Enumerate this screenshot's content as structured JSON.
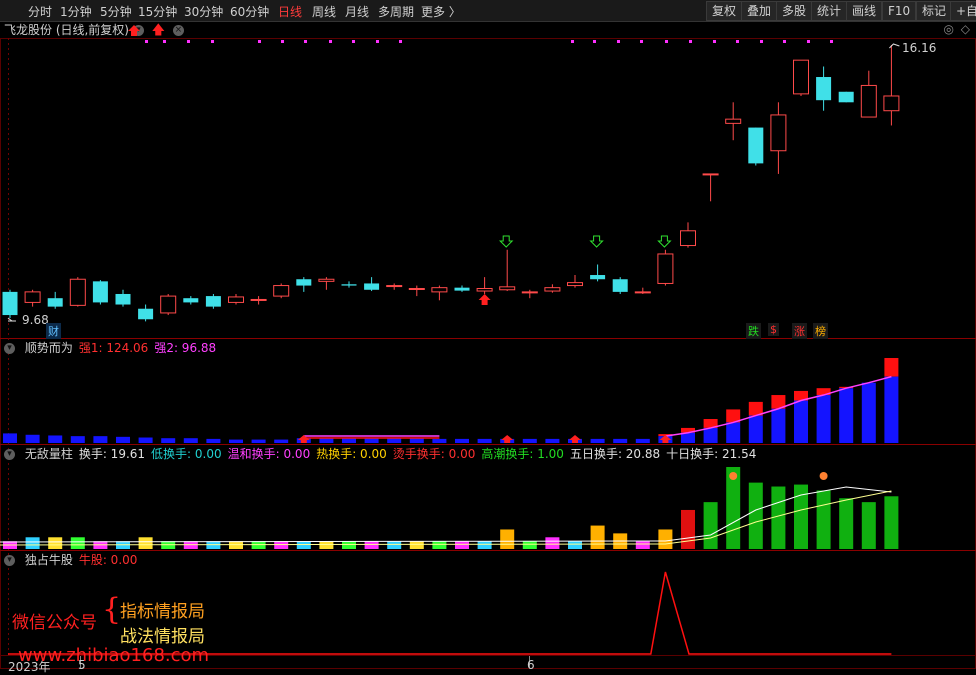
{
  "toolbar": {
    "periods": [
      "分时",
      "1分钟",
      "5分钟",
      "15分钟",
      "30分钟",
      "60分钟",
      "日线",
      "周线",
      "月线",
      "多周期",
      "更多 〉"
    ],
    "active_period": "日线",
    "buttons": [
      "复权",
      "叠加",
      "多股",
      "统计",
      "画线",
      "F10",
      "标记",
      "+自选"
    ]
  },
  "chart": {
    "stock_title": "飞龙股份 (日线,前复权)",
    "high_label": "16.16",
    "low_label": "9.68",
    "finance_tag": "财",
    "tags": [
      {
        "text": "跌",
        "color": "#22dd22"
      },
      {
        "text": "$",
        "color": "#ff3030"
      },
      {
        "text": "涨",
        "color": "#ff3030"
      },
      {
        "text": "榜",
        "color": "#ffb000"
      }
    ]
  },
  "panel2": {
    "name": "顺势而为",
    "items": [
      {
        "label": "强1: 124.06",
        "color": "#ff3030"
      },
      {
        "label": "强2: 96.88",
        "color": "#ff40ff"
      }
    ]
  },
  "panel3": {
    "name": "无敌量柱",
    "items": [
      {
        "label": "换手: 19.61",
        "color": "#e0e0e0"
      },
      {
        "label": "低换手: 0.00",
        "color": "#20d0d0"
      },
      {
        "label": "温和换手: 0.00",
        "color": "#ff40ff"
      },
      {
        "label": "热换手: 0.00",
        "color": "#ffd000"
      },
      {
        "label": "烫手换手: 0.00",
        "color": "#ff3030"
      },
      {
        "label": "高潮换手: 1.00",
        "color": "#22dd22"
      },
      {
        "label": "五日换手: 20.88",
        "color": "#e0e0e0"
      },
      {
        "label": "十日换手: 21.54",
        "color": "#e0e0e0"
      }
    ]
  },
  "panel4": {
    "name": "独占牛股",
    "items": [
      {
        "label": "牛股: 0.00",
        "color": "#ff3030"
      }
    ]
  },
  "watermark": {
    "wechat_label": "微信公众号",
    "line1": "指标情报局",
    "line2": "战法情报局",
    "url": "www.zhibiao168.com"
  },
  "x_axis": {
    "year": "2023年",
    "m5": "5",
    "m6": "6"
  },
  "candles": [
    {
      "o": 10.3,
      "c": 9.75,
      "h": 10.35,
      "l": 9.68
    },
    {
      "o": 10.05,
      "c": 10.3,
      "h": 10.35,
      "l": 9.95
    },
    {
      "o": 10.15,
      "c": 9.95,
      "h": 10.3,
      "l": 9.9
    },
    {
      "o": 9.98,
      "c": 10.6,
      "h": 10.65,
      "l": 9.95
    },
    {
      "o": 10.55,
      "c": 10.05,
      "h": 10.58,
      "l": 10.0
    },
    {
      "o": 10.25,
      "c": 10.0,
      "h": 10.35,
      "l": 9.95
    },
    {
      "o": 9.9,
      "c": 9.65,
      "h": 10.0,
      "l": 9.6
    },
    {
      "o": 9.8,
      "c": 10.2,
      "h": 10.25,
      "l": 9.75
    },
    {
      "o": 10.15,
      "c": 10.05,
      "h": 10.2,
      "l": 10.0
    },
    {
      "o": 10.2,
      "c": 9.95,
      "h": 10.25,
      "l": 9.9
    },
    {
      "o": 10.05,
      "c": 10.18,
      "h": 10.25,
      "l": 10.0
    },
    {
      "o": 10.12,
      "c": 10.12,
      "h": 10.2,
      "l": 10.0
    },
    {
      "o": 10.2,
      "c": 10.45,
      "h": 10.5,
      "l": 10.15
    },
    {
      "o": 10.6,
      "c": 10.45,
      "h": 10.65,
      "l": 10.3
    },
    {
      "o": 10.55,
      "c": 10.6,
      "h": 10.65,
      "l": 10.35
    },
    {
      "o": 10.48,
      "c": 10.45,
      "h": 10.55,
      "l": 10.4
    },
    {
      "o": 10.5,
      "c": 10.35,
      "h": 10.65,
      "l": 10.32
    },
    {
      "o": 10.43,
      "c": 10.45,
      "h": 10.5,
      "l": 10.35
    },
    {
      "o": 10.38,
      "c": 10.38,
      "h": 10.45,
      "l": 10.2
    },
    {
      "o": 10.3,
      "c": 10.4,
      "h": 10.45,
      "l": 10.1
    },
    {
      "o": 10.4,
      "c": 10.33,
      "h": 10.45,
      "l": 10.3
    },
    {
      "o": 10.32,
      "c": 10.38,
      "h": 10.65,
      "l": 10.25
    },
    {
      "o": 10.35,
      "c": 10.42,
      "h": 11.3,
      "l": 10.32
    },
    {
      "o": 10.3,
      "c": 10.3,
      "h": 10.35,
      "l": 10.15
    },
    {
      "o": 10.32,
      "c": 10.4,
      "h": 10.48,
      "l": 10.28
    },
    {
      "o": 10.45,
      "c": 10.52,
      "h": 10.7,
      "l": 10.4
    },
    {
      "o": 10.7,
      "c": 10.6,
      "h": 10.95,
      "l": 10.55
    },
    {
      "o": 10.6,
      "c": 10.3,
      "h": 10.65,
      "l": 10.25
    },
    {
      "o": 10.3,
      "c": 10.3,
      "h": 10.4,
      "l": 10.25
    },
    {
      "o": 10.5,
      "c": 11.2,
      "h": 11.3,
      "l": 10.45
    },
    {
      "o": 11.4,
      "c": 11.75,
      "h": 11.95,
      "l": 11.35
    },
    {
      "o": 13.1,
      "c": 13.1,
      "h": 13.1,
      "l": 12.45
    },
    {
      "o": 14.3,
      "c": 14.4,
      "h": 14.8,
      "l": 13.9
    },
    {
      "o": 14.2,
      "c": 13.35,
      "h": 14.2,
      "l": 13.3
    },
    {
      "o": 13.65,
      "c": 14.5,
      "h": 14.8,
      "l": 13.1
    },
    {
      "o": 15.0,
      "c": 15.8,
      "h": 15.8,
      "l": 14.95
    },
    {
      "o": 15.4,
      "c": 14.85,
      "h": 15.65,
      "l": 14.6
    },
    {
      "o": 15.05,
      "c": 14.8,
      "h": 15.05,
      "l": 14.8
    },
    {
      "o": 14.45,
      "c": 15.2,
      "h": 15.55,
      "l": 14.45
    },
    {
      "o": 14.6,
      "c": 14.95,
      "h": 16.16,
      "l": 14.25
    }
  ],
  "strength_bars": [
    {
      "blue": 14,
      "red": 14
    },
    {
      "blue": 12,
      "red": 12
    },
    {
      "blue": 11,
      "red": 11
    },
    {
      "blue": 10,
      "red": 10
    },
    {
      "blue": 10,
      "red": 10
    },
    {
      "blue": 9,
      "red": 9
    },
    {
      "blue": 8,
      "red": 8
    },
    {
      "blue": 7,
      "red": 7
    },
    {
      "blue": 7,
      "red": 7
    },
    {
      "blue": 6,
      "red": 6
    },
    {
      "blue": 5,
      "red": 5
    },
    {
      "blue": 5,
      "red": 5
    },
    {
      "blue": 5,
      "red": 5
    },
    {
      "blue": 7,
      "red": 7
    },
    {
      "blue": 7,
      "red": 7
    },
    {
      "blue": 7,
      "red": 7
    },
    {
      "blue": 7,
      "red": 7
    },
    {
      "blue": 7,
      "red": 7
    },
    {
      "blue": 7,
      "red": 7
    },
    {
      "blue": 6,
      "red": 6
    },
    {
      "blue": 6,
      "red": 6
    },
    {
      "blue": 6,
      "red": 6
    },
    {
      "blue": 6,
      "red": 6
    },
    {
      "blue": 6,
      "red": 6
    },
    {
      "blue": 6,
      "red": 6
    },
    {
      "blue": 6,
      "red": 6
    },
    {
      "blue": 6,
      "red": 6
    },
    {
      "blue": 6,
      "red": 6
    },
    {
      "blue": 6,
      "red": 6
    },
    {
      "blue": 10,
      "red": 13
    },
    {
      "blue": 15,
      "red": 22
    },
    {
      "blue": 22,
      "red": 35
    },
    {
      "blue": 30,
      "red": 49
    },
    {
      "blue": 40,
      "red": 60
    },
    {
      "blue": 50,
      "red": 70
    },
    {
      "blue": 62,
      "red": 76
    },
    {
      "blue": 70,
      "red": 80
    },
    {
      "blue": 80,
      "red": 82
    },
    {
      "blue": 88,
      "red": 83
    },
    {
      "blue": 96.88,
      "red": 124.06
    }
  ],
  "volume_bars": [
    {
      "v": 2,
      "c": "multi"
    },
    {
      "v": 3,
      "c": "multi"
    },
    {
      "v": 3,
      "c": "multi"
    },
    {
      "v": 3,
      "c": "multi"
    },
    {
      "v": 2,
      "c": "multi"
    },
    {
      "v": 2,
      "c": "multi"
    },
    {
      "v": 3,
      "c": "multi"
    },
    {
      "v": 2,
      "c": "multi"
    },
    {
      "v": 2,
      "c": "multi"
    },
    {
      "v": 2,
      "c": "multi"
    },
    {
      "v": 2,
      "c": "multi"
    },
    {
      "v": 2,
      "c": "multi"
    },
    {
      "v": 2,
      "c": "multi"
    },
    {
      "v": 2,
      "c": "multi"
    },
    {
      "v": 2,
      "c": "multi"
    },
    {
      "v": 2,
      "c": "multi"
    },
    {
      "v": 2,
      "c": "multi"
    },
    {
      "v": 2,
      "c": "multi"
    },
    {
      "v": 2,
      "c": "multi"
    },
    {
      "v": 2,
      "c": "multi"
    },
    {
      "v": 2,
      "c": "multi"
    },
    {
      "v": 2,
      "c": "multi"
    },
    {
      "v": 5,
      "c": "hot"
    },
    {
      "v": 2,
      "c": "multi"
    },
    {
      "v": 3,
      "c": "multi"
    },
    {
      "v": 2,
      "c": "multi"
    },
    {
      "v": 6,
      "c": "hot"
    },
    {
      "v": 4,
      "c": "hot"
    },
    {
      "v": 2,
      "c": "multi"
    },
    {
      "v": 5,
      "c": "hot"
    },
    {
      "v": 10,
      "c": "red"
    },
    {
      "v": 12,
      "c": "green"
    },
    {
      "v": 21,
      "c": "green"
    },
    {
      "v": 17,
      "c": "green"
    },
    {
      "v": 16,
      "c": "green"
    },
    {
      "v": 16.5,
      "c": "green"
    },
    {
      "v": 15,
      "c": "green"
    },
    {
      "v": 13,
      "c": "green"
    },
    {
      "v": 12,
      "c": "green"
    },
    {
      "v": 13.5,
      "c": "green"
    }
  ],
  "bull_line": [
    0,
    0,
    0,
    0,
    0,
    0,
    0,
    0,
    0,
    0,
    0,
    0,
    0,
    0,
    0,
    0,
    0,
    0,
    0,
    0,
    0,
    0,
    0,
    0,
    0,
    0,
    0,
    0,
    0,
    0,
    1,
    0,
    0,
    0,
    0,
    0,
    0,
    0,
    0,
    0
  ]
}
